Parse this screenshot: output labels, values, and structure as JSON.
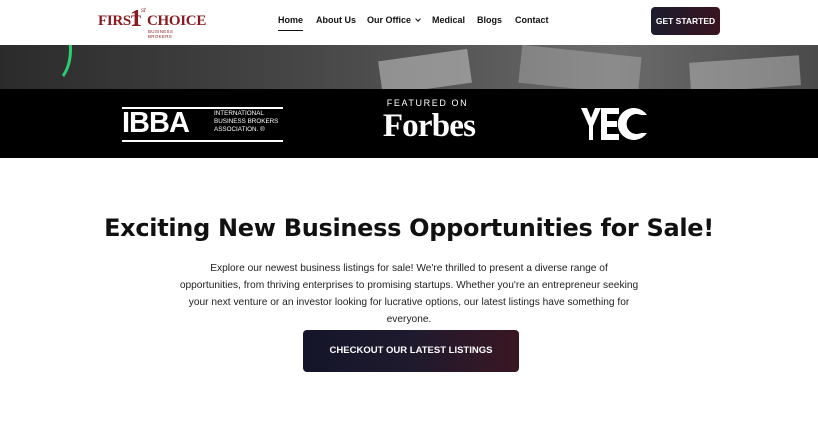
{
  "brand": {
    "name_part1": "FIRST",
    "name_numeral": "1",
    "name_ordinal": "st",
    "name_part2": "CHOICE",
    "tagline": "BUSINESS BROKERS",
    "color": "#8b1a1f"
  },
  "nav": {
    "items": [
      {
        "label": "Home",
        "active": true
      },
      {
        "label": "About Us"
      },
      {
        "label": "Our Office",
        "has_dropdown": true
      },
      {
        "label": "Medical"
      },
      {
        "label": "Blogs"
      },
      {
        "label": "Contact"
      }
    ]
  },
  "header_cta": {
    "label": "GET STARTED"
  },
  "partners": {
    "ibba": {
      "mark": "IBBA",
      "line1": "INTERNATIONAL",
      "line2": "BUSINESS BROKERS",
      "line3": "ASSOCIATION. ®"
    },
    "forbes": {
      "featured": "FEATURED ON",
      "name": "Forbes"
    },
    "yec": {
      "mark": "YEC"
    }
  },
  "hero": {
    "title": "Exciting New Business Opportunities for Sale!",
    "description": "Explore our newest business listings for sale! We're thrilled to present a diverse range of opportunities, from thriving enterprises to promising startups. Whether you're an entrepreneur seeking your next venture or an investor looking for lucrative options, our latest listings have something for everyone.",
    "cta_label": "CHECKOUT OUR LATEST LISTINGS"
  },
  "colors": {
    "accent_green": "#2ecc71",
    "button_dark": "#1a1c2e",
    "button_maroon": "#3a1420"
  }
}
